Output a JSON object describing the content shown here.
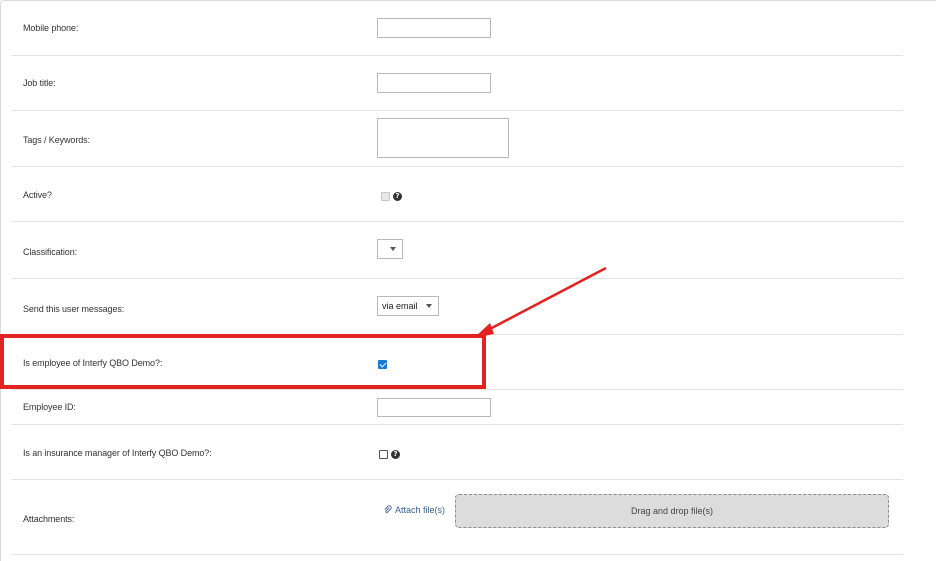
{
  "form": {
    "rows": [
      {
        "label": "Mobile phone:"
      },
      {
        "label": "Job title:"
      },
      {
        "label": "Tags / Keywords:"
      },
      {
        "label": "Active?"
      },
      {
        "label": "Classification:"
      },
      {
        "label": "Send this user messages:"
      },
      {
        "label": "Is employee of Interfy QBO Demo?:"
      },
      {
        "label": "Employee ID:"
      },
      {
        "label": "Is an insurance manager of Interfy QBO Demo?:"
      },
      {
        "label": "Attachments:"
      }
    ],
    "mobile_phone_value": "",
    "job_title_value": "",
    "tags_value": "",
    "active_checked": false,
    "classification_value": "",
    "messages_value": "via email",
    "is_employee_checked": true,
    "employee_id_value": "",
    "insurance_manager_checked": false,
    "help_glyph": "?",
    "attach_label": "Attach file(s)",
    "dropzone_label": "Drag and drop file(s)"
  },
  "annotation": {
    "color": "#e32222"
  }
}
